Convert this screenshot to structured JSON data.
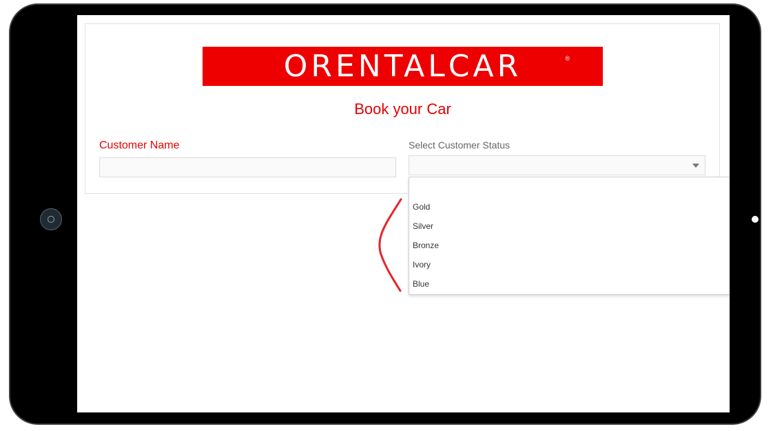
{
  "logo": {
    "text": "ORENTALCAR",
    "registered": "®",
    "color": "#ee0000"
  },
  "form": {
    "title": "Book your Car",
    "customer_name": {
      "label": "Customer Name",
      "value": "",
      "placeholder": ""
    },
    "customer_status": {
      "label": "Select Customer Status",
      "selected": "",
      "options": [
        "",
        "Gold",
        "Silver",
        "Bronze",
        "Ivory",
        "Blue"
      ]
    }
  },
  "colors": {
    "accent": "#e60000",
    "annotation": "#e8232a"
  },
  "icons": {
    "select": "chevron-down-icon"
  }
}
